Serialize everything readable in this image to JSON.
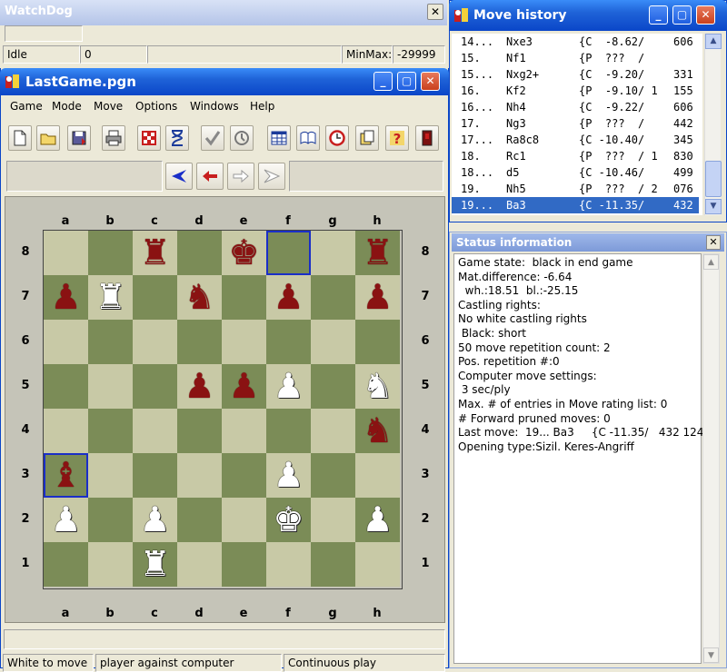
{
  "watchdog": {
    "title": "WatchDog",
    "status": "Idle",
    "count": "0",
    "minmax_label": "MinMax:",
    "minmax_value": "-29999"
  },
  "game_window": {
    "title": "LastGame.pgn",
    "menu": [
      "Game",
      "Mode",
      "Move",
      "Options",
      "Windows",
      "Help"
    ],
    "toolbar_icons": [
      "new-file-icon",
      "open-folder-icon",
      "save-icon",
      "print-icon",
      "board-setup-icon",
      "hourglass-icon",
      "checkmark-icon",
      "analysis-icon",
      "table-icon",
      "book-icon",
      "clock-icon",
      "copy-icon",
      "help-icon",
      "exit-icon"
    ],
    "nav_icons": [
      "first-move-icon",
      "previous-move-icon",
      "next-move-icon",
      "last-move-icon"
    ],
    "files": [
      "a",
      "b",
      "c",
      "d",
      "e",
      "f",
      "g",
      "h"
    ],
    "ranks": [
      "8",
      "7",
      "6",
      "5",
      "4",
      "3",
      "2",
      "1"
    ],
    "status_bar": [
      "White to move",
      "player against computer",
      "Continuous play"
    ]
  },
  "board": {
    "pieces": [
      {
        "sq": "c8",
        "color": "b",
        "glyph": "♜"
      },
      {
        "sq": "e8",
        "color": "b",
        "glyph": "♚"
      },
      {
        "sq": "h8",
        "color": "b",
        "glyph": "♜"
      },
      {
        "sq": "a7",
        "color": "b",
        "glyph": "♟"
      },
      {
        "sq": "b7",
        "color": "w",
        "glyph": "♜"
      },
      {
        "sq": "d7",
        "color": "b",
        "glyph": "♞"
      },
      {
        "sq": "f7",
        "color": "b",
        "glyph": "♟"
      },
      {
        "sq": "h7",
        "color": "b",
        "glyph": "♟"
      },
      {
        "sq": "d5",
        "color": "b",
        "glyph": "♟"
      },
      {
        "sq": "e5",
        "color": "b",
        "glyph": "♟"
      },
      {
        "sq": "f5",
        "color": "w",
        "glyph": "♟"
      },
      {
        "sq": "h5",
        "color": "w",
        "glyph": "♞"
      },
      {
        "sq": "h4",
        "color": "b",
        "glyph": "♞"
      },
      {
        "sq": "a3",
        "color": "b",
        "glyph": "♝"
      },
      {
        "sq": "f3",
        "color": "w",
        "glyph": "♟"
      },
      {
        "sq": "a2",
        "color": "w",
        "glyph": "♟"
      },
      {
        "sq": "c2",
        "color": "w",
        "glyph": "♟"
      },
      {
        "sq": "f2",
        "color": "w",
        "glyph": "♚"
      },
      {
        "sq": "h2",
        "color": "w",
        "glyph": "♟"
      },
      {
        "sq": "c1",
        "color": "w",
        "glyph": "♜"
      }
    ],
    "highlight": [
      "f8",
      "a3"
    ]
  },
  "move_history": {
    "title": "Move history",
    "rows": [
      {
        "num": "14...",
        "move": "Nxe3",
        "eval": "{C  -8.62/",
        "nodes": "606"
      },
      {
        "num": "15.",
        "move": "Nf1",
        "eval": "{P  ???  /",
        "nodes": ""
      },
      {
        "num": "15...",
        "move": "Nxg2+",
        "eval": "{C  -9.20/",
        "nodes": "331"
      },
      {
        "num": "16.",
        "move": "Kf2",
        "eval": "{P  -9.10/ 1",
        "nodes": "155"
      },
      {
        "num": "16...",
        "move": "Nh4",
        "eval": "{C  -9.22/",
        "nodes": "606"
      },
      {
        "num": "17.",
        "move": "Ng3",
        "eval": "{P  ???  /",
        "nodes": "442"
      },
      {
        "num": "17...",
        "move": "Ra8c8",
        "eval": "{C -10.40/",
        "nodes": "345"
      },
      {
        "num": "18.",
        "move": "Rc1",
        "eval": "{P  ???  / 1",
        "nodes": "830"
      },
      {
        "num": "18...",
        "move": "d5",
        "eval": "{C -10.46/",
        "nodes": "499"
      },
      {
        "num": "19.",
        "move": "Nh5",
        "eval": "{P  ???  / 2",
        "nodes": "076"
      },
      {
        "num": "19...",
        "move": "Ba3",
        "eval": "{C -11.35/",
        "nodes": "432"
      }
    ],
    "selected_index": 10
  },
  "status_info": {
    "title": "Status information",
    "lines": [
      "Game state:  black in end game",
      "Mat.difference: -6.64",
      "  wh.:18.51  bl.:-25.15",
      "Castling rights:",
      "No white castling rights",
      " Black: short",
      "50 move repetition count: 2",
      "Pos. repetition #:0",
      "Computer move settings:",
      " 3 sec/ply",
      "Max. # of entries in Move rating list: 0",
      "# Forward pruned moves: 0",
      "Last move:  19... Ba3     {C -11.35/   432 124}",
      "Opening type:Sizil. Keres-Angriff"
    ]
  }
}
